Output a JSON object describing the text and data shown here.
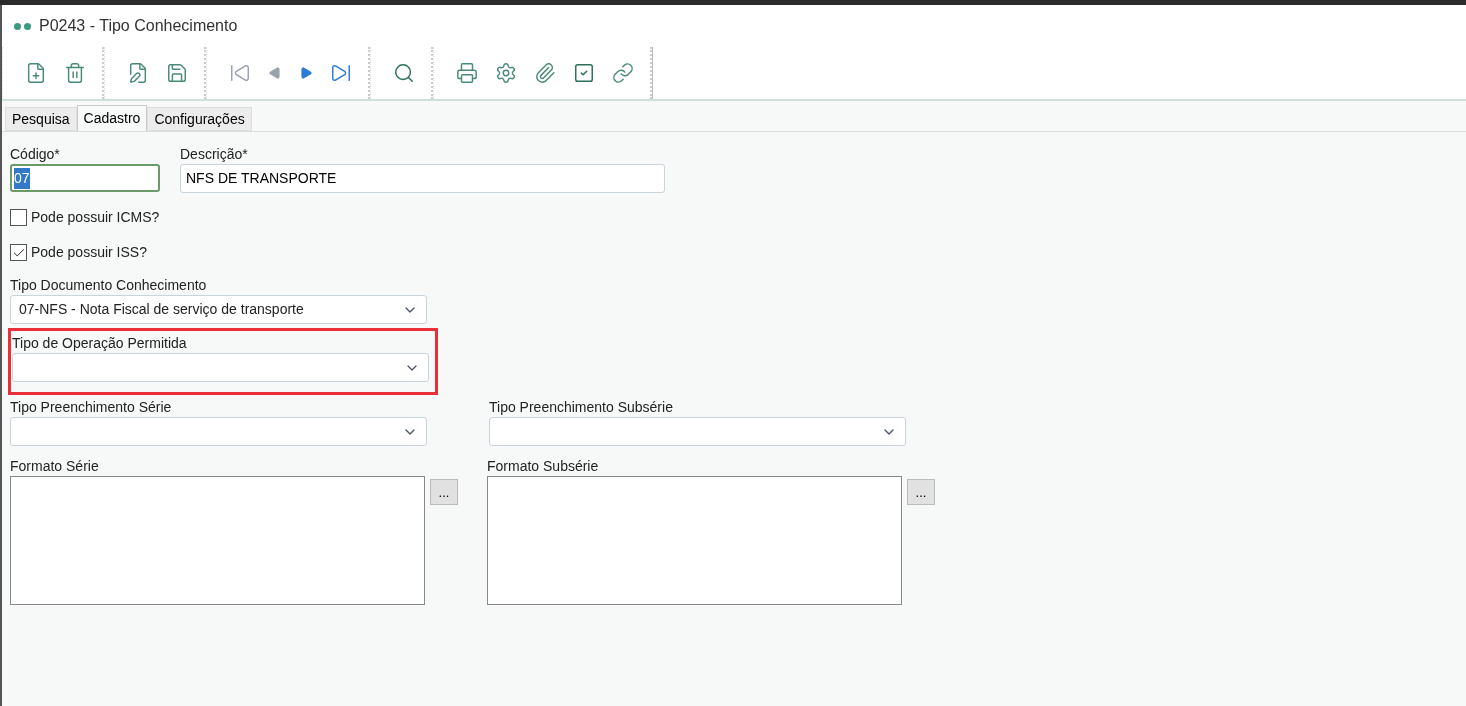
{
  "window": {
    "title": "P0243 - Tipo Conhecimento"
  },
  "toolbar": {
    "groups": [
      [
        {
          "kind": "new"
        },
        {
          "kind": "delete"
        }
      ],
      [
        {
          "kind": "edit"
        },
        {
          "kind": "save"
        }
      ],
      [
        {
          "kind": "first"
        },
        {
          "kind": "previous"
        },
        {
          "kind": "next"
        },
        {
          "kind": "last"
        }
      ],
      [
        {
          "kind": "search"
        }
      ],
      [
        {
          "kind": "print"
        },
        {
          "kind": "settings"
        },
        {
          "kind": "attach"
        },
        {
          "kind": "check"
        },
        {
          "kind": "link"
        }
      ]
    ]
  },
  "tabs": [
    {
      "label": "Pesquisa",
      "selected": false
    },
    {
      "label": "Cadastro",
      "selected": true
    },
    {
      "label": "Configurações",
      "selected": false
    }
  ],
  "codigo": {
    "label": "Código*",
    "value": "07"
  },
  "descricao": {
    "label": "Descrição*",
    "value": "NFS DE TRANSPORTE"
  },
  "checkboxes": [
    {
      "label": "Pode possuir ICMS?",
      "checked": false
    },
    {
      "label": "Pode possuir ISS?",
      "checked": true
    }
  ],
  "tipo_documento": {
    "label": "Tipo Documento Conhecimento",
    "value": "07-NFS - Nota Fiscal de serviço de transporte"
  },
  "tipo_operacao": {
    "label": "Tipo de Operação Permitida",
    "highlighted": true
  },
  "tipo_serie": {
    "label": "Tipo Preenchimento Série"
  },
  "tipo_subserie": {
    "label": "Tipo Preenchimento Subsérie"
  },
  "formato_serie": {
    "label": "Formato Série",
    "button": "..."
  },
  "formato_subserie": {
    "label": "Formato Subsérie",
    "button": "..."
  }
}
